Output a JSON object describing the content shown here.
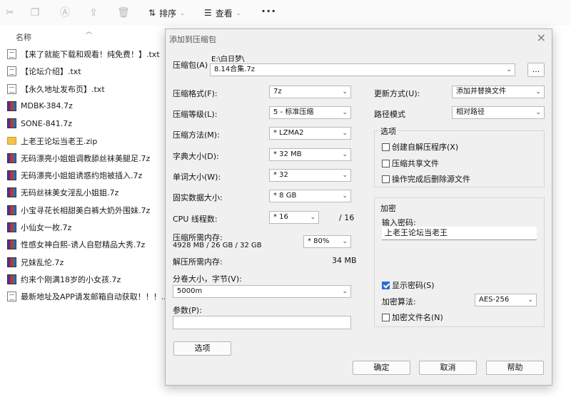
{
  "toolbar": {
    "sort_label": "排序",
    "view_label": "查看",
    "more_label": "···"
  },
  "columns": {
    "name": "名称"
  },
  "files": [
    {
      "name": "【来了就能下载和观看！纯免费！】.txt",
      "type": "txt"
    },
    {
      "name": "【论坛介绍】.txt",
      "type": "txt"
    },
    {
      "name": "【永久地址发布页】.txt",
      "type": "txt"
    },
    {
      "name": "MDBK-384.7z",
      "type": "rar"
    },
    {
      "name": "SONE-841.7z",
      "type": "rar"
    },
    {
      "name": "上老王论坛当老王.zip",
      "type": "zip"
    },
    {
      "name": "无码漂亮小姐姐调教舔丝袜美腿足.7z",
      "type": "rar"
    },
    {
      "name": "无码漂亮小姐姐诱惑约炮被插入.7z",
      "type": "rar"
    },
    {
      "name": "无码丝袜美女淫乱小姐姐.7z",
      "type": "rar"
    },
    {
      "name": "小宝寻花长相甜美白裤大奶外围妹.7z",
      "type": "rar"
    },
    {
      "name": "小仙女一枚.7z",
      "type": "rar"
    },
    {
      "name": "性感女神白熙-诱人自慰精品大秀.7z",
      "type": "rar"
    },
    {
      "name": "兄妹乱伦.7z",
      "type": "rar"
    },
    {
      "name": "约来个刚满18岁的小女孩.7z",
      "type": "rar"
    },
    {
      "name": "最新地址及APP请发邮箱自动获取！！！....",
      "type": "txt"
    }
  ],
  "dialog": {
    "title": "添加到压缩包",
    "close": "×",
    "archive_label": "压缩包(A)",
    "archive_dir": "E:\\白日梦\\",
    "archive_name": "8.14合集.7z",
    "browse_label": "...",
    "format_label": "压缩格式(F):",
    "format_value": "7z",
    "level_label": "压缩等级(L):",
    "level_value": "5 - 标准压缩",
    "method_label": "压缩方法(M):",
    "method_value": "* LZMA2",
    "dict_label": "字典大小(D):",
    "dict_value": "* 32 MB",
    "word_label": "单词大小(W):",
    "word_value": "* 32",
    "solid_label": "固实数据大小:",
    "solid_value": "* 8 GB",
    "cpu_label": "CPU 线程数:",
    "cpu_value": "* 16",
    "cpu_total": "/ 16",
    "mem_comp_label": "压缩所需内存:",
    "mem_comp_value": "4928 MB / 26 GB / 32 GB",
    "mem_percent": "* 80%",
    "mem_decomp_label": "解压所需内存:",
    "mem_decomp_value": "34 MB",
    "split_label": "分卷大小，字节(V):",
    "split_value": "5000m",
    "params_label": "参数(P):",
    "params_value": "",
    "options_button": "选项",
    "update_label": "更新方式(U):",
    "update_value": "添加并替换文件",
    "path_label": "路径模式",
    "path_value": "相对路径",
    "options_group": "选项",
    "opt_sfx": "创建自解压程序(X)",
    "opt_shared": "压缩共享文件",
    "opt_delete": "操作完成后删除源文件",
    "encrypt_group": "加密",
    "password_label": "输入密码:",
    "password_value": "上老王论坛当老王",
    "show_password": "显示密码(S)",
    "enc_method_label": "加密算法:",
    "enc_method_value": "AES-256",
    "enc_names": "加密文件名(N)",
    "ok": "确定",
    "cancel": "取消",
    "help": "帮助"
  }
}
